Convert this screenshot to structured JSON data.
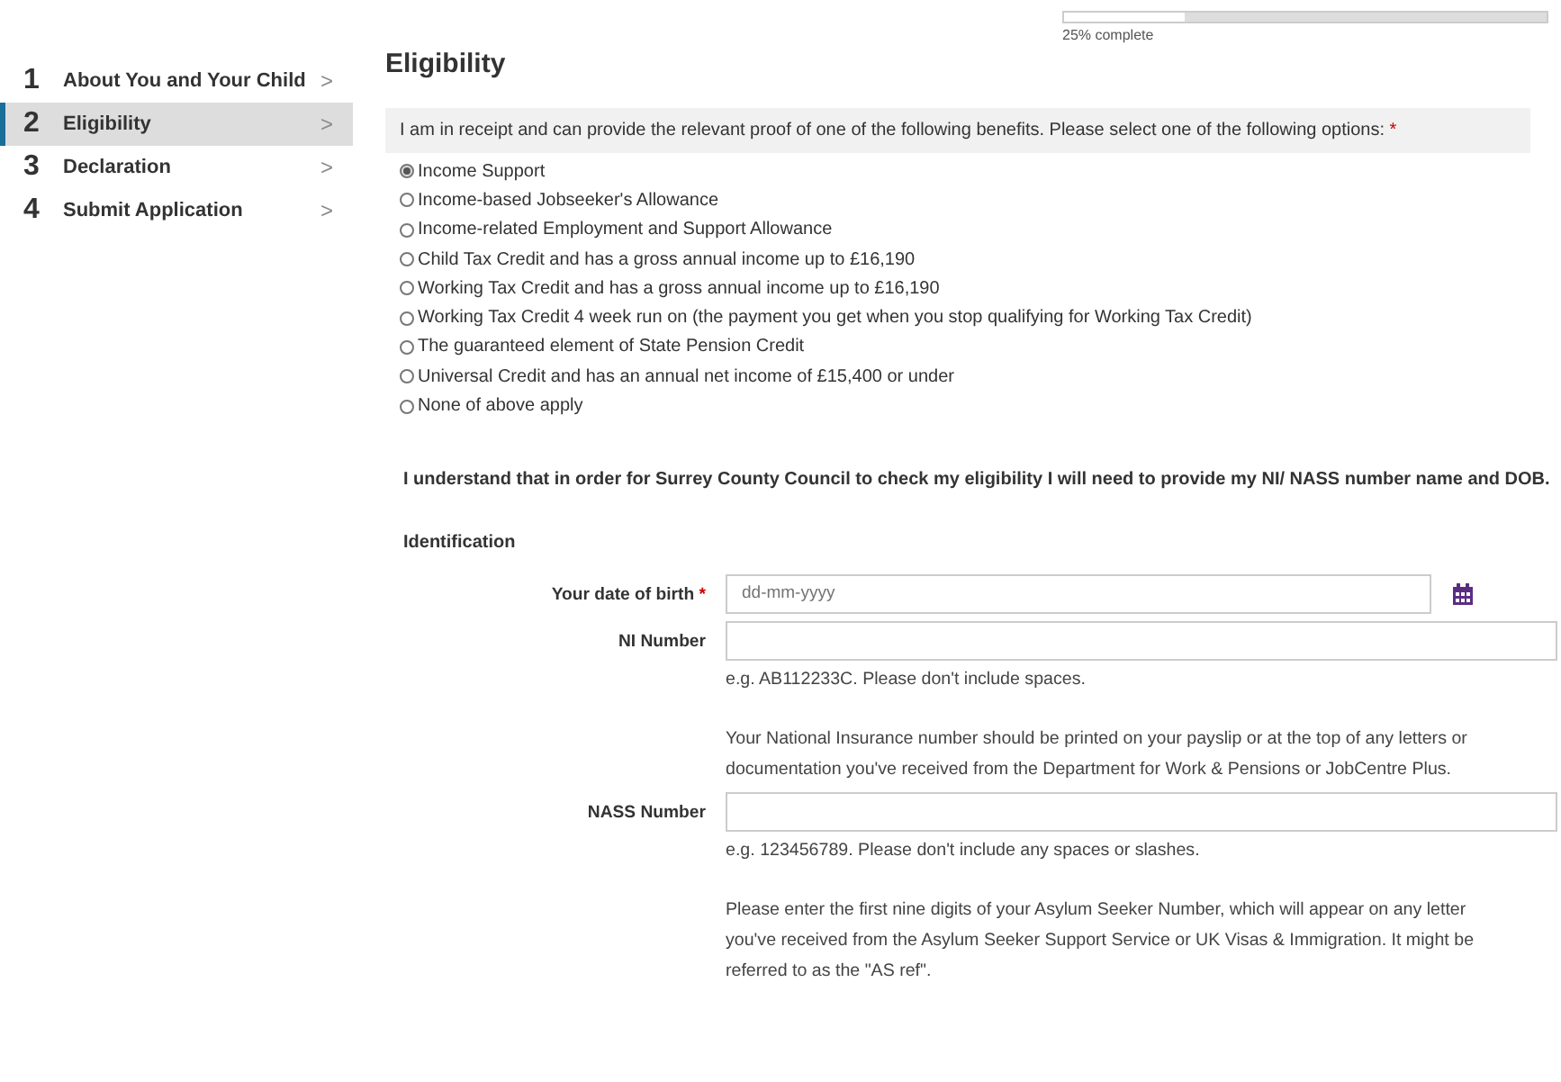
{
  "progress": {
    "level": 0.25,
    "label": "25% complete"
  },
  "steps": [
    {
      "number": "1",
      "label": "About You and Your Child",
      "chevron": ">",
      "selected": false
    },
    {
      "number": "2",
      "label": "Eligibility",
      "chevron": ">",
      "selected": true
    },
    {
      "number": "3",
      "label": "Declaration",
      "chevron": ">",
      "selected": false
    },
    {
      "number": "4",
      "label": "Submit Application",
      "chevron": ">",
      "selected": false
    }
  ],
  "heading": "Eligibility",
  "question": {
    "text": "I am in receipt and can provide the relevant proof of one of the following benefits. Please select one of the following options:",
    "required_mark": "*"
  },
  "options": [
    {
      "label": "Income Support",
      "selected": true
    },
    {
      "label": "Income-based Jobseeker's Allowance",
      "selected": false
    },
    {
      "label": "Income-related Employment and Support Allowance",
      "selected": false
    },
    {
      "label": "Child Tax Credit and has a gross annual income up to £16,190",
      "selected": false
    },
    {
      "label": "Working Tax Credit and has a gross annual income up to £16,190",
      "selected": false
    },
    {
      "label": "Working Tax Credit 4 week run on (the payment you get when you stop qualifying for Working Tax Credit)",
      "selected": false
    },
    {
      "label": "The guaranteed element of State Pension Credit",
      "selected": false
    },
    {
      "label": "Universal Credit and has an annual net income of £15,400 or under",
      "selected": false
    },
    {
      "label": "None of above apply",
      "selected": false
    }
  ],
  "statement": "I understand that in order for Surrey County Council to check my eligibility I will need to provide my NI/ NASS number name and DOB.",
  "section": "Identification",
  "fields": [
    {
      "kind": "date",
      "label": "Your date of birth",
      "required_mark": "*",
      "placeholder": "dd-mm-yyyy"
    },
    {
      "kind": "text",
      "label": "NI Number",
      "hints": [
        "e.g. AB112233C. Please don't include spaces.",
        "Your National Insurance number should be printed on your payslip or at the top of any letters or documentation you've received from the Department for Work & Pensions or JobCentre Plus."
      ]
    },
    {
      "kind": "text",
      "label": "NASS Number",
      "hints": [
        "e.g. 123456789. Please don't include any spaces or slashes.",
        "Please enter the first nine digits of your Asylum Seeker Number, which will appear on any letter you've received from the Asylum Seeker Support Service or UK Visas & Immigration. It might be referred to as the \"AS ref\"."
      ]
    }
  ]
}
